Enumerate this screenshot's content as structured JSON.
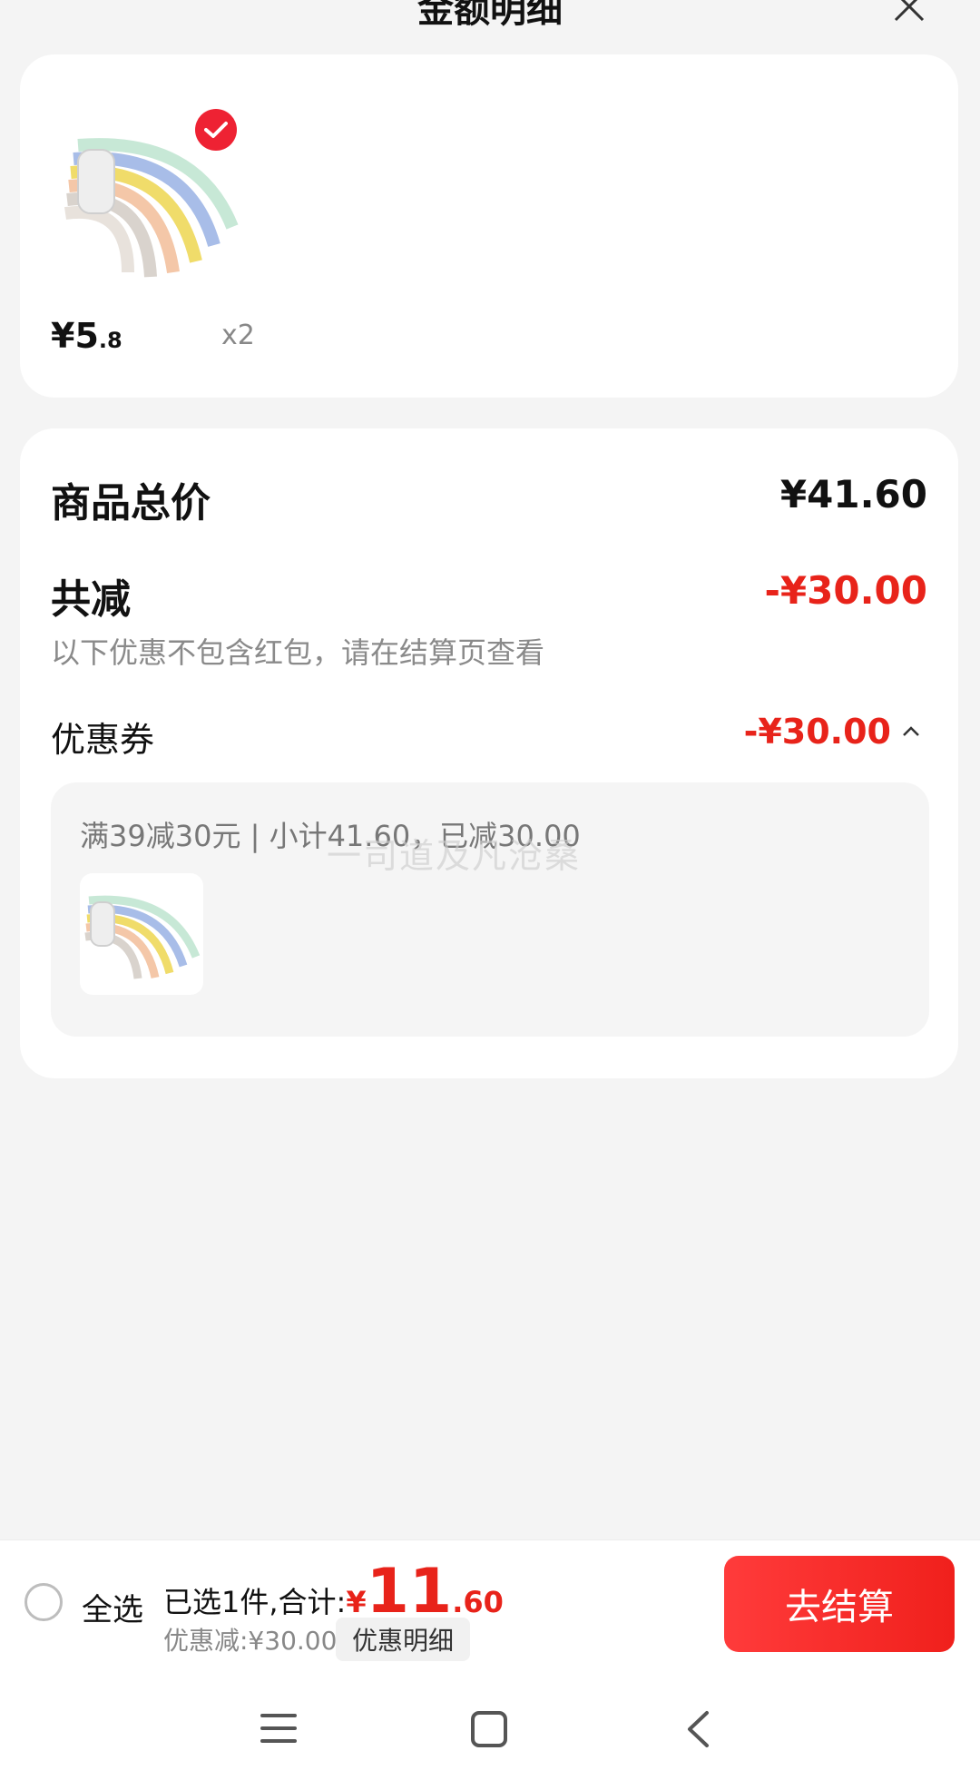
{
  "header": {
    "title": "金额明细"
  },
  "product": {
    "price_int": "¥5",
    "price_dec": ".8",
    "quantity": "x2",
    "selected": true
  },
  "summary": {
    "total_label": "商品总价",
    "total_value": "¥41.60",
    "reduction_label": "共减",
    "reduction_value": "-¥30.00",
    "reduction_note": "以下优惠不包含红包，请在结算页查看",
    "coupon_label": "优惠券",
    "coupon_value": "-¥30.00",
    "coupon_detail": "满39减30元 | 小计41.60，已减30.00"
  },
  "watermark": "一司道及凡沧桑",
  "bottom_bar": {
    "select_all_label": "全选",
    "selected_text": "已选1件,合计:",
    "currency": "¥",
    "total_int": "11",
    "total_dec": ".60",
    "discount_text": "优惠减:¥30.00",
    "detail_button": "优惠明细",
    "checkout_button": "去结算"
  },
  "colors": {
    "accent_red": "#e8231a",
    "background": "#f4f4f4",
    "card": "#ffffff"
  },
  "icons": [
    "close-icon",
    "check-icon",
    "chevron-up-icon",
    "menu-icon",
    "home-icon",
    "back-icon"
  ]
}
